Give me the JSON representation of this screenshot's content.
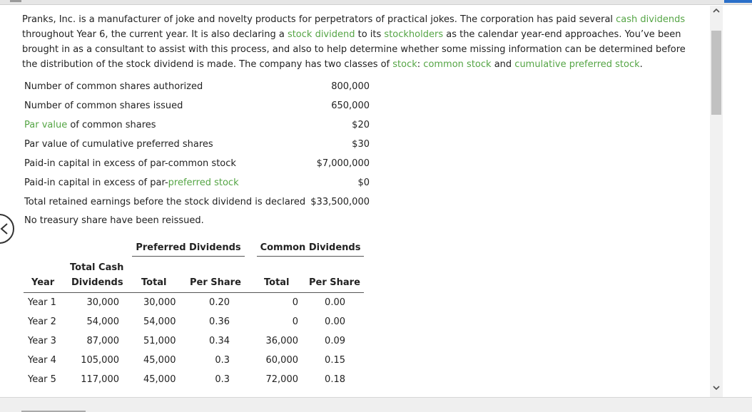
{
  "intro": {
    "t1": "Pranks, Inc. is a manufacturer of joke and novelty products for perpetrators of practical jokes. The corporation has paid several ",
    "l1": "cash dividends",
    "t2": " throughout Year 6, the current year. It is also declaring a ",
    "l2": "stock dividend",
    "t3": " to its ",
    "l3": "stockholders",
    "t4": " as the calendar year-end approaches. You’ve been brought in as a consultant to assist with this process, and also to help determine whether some missing information can be determined before the distribution of the stock dividend is made. The company has two classes of ",
    "l4": "stock",
    "t5": ": ",
    "l5": "common stock",
    "t6": " and ",
    "l6": "cumulative preferred stock",
    "t7": "."
  },
  "facts": [
    {
      "label": "Number of common shares authorized",
      "value": "800,000"
    },
    {
      "label": "Number of common shares issued",
      "value": "650,000"
    },
    {
      "label_link": "Par value",
      "label_rest": " of common shares",
      "value": "$20"
    },
    {
      "label": "Par value of cumulative preferred shares",
      "value": "$30"
    },
    {
      "label": "Paid-in capital in excess of par-common stock",
      "value": "$7,000,000"
    },
    {
      "label_pre": "Paid-in capital in excess of par-",
      "label_link": "preferred stock",
      "value": "$0"
    },
    {
      "label": "Total retained earnings before the stock dividend is declared",
      "value": "$33,500,000"
    }
  ],
  "note": "No treasury share have been reissued.",
  "table": {
    "group_preferred": "Preferred Dividends",
    "group_common": "Common Dividends",
    "headers": {
      "year": "Year",
      "total_cash_1": "Total Cash",
      "total_cash_2": "Dividends",
      "pref_total": "Total",
      "pref_per_share": "Per Share",
      "common_total": "Total",
      "common_per_share": "Per Share"
    },
    "rows": [
      {
        "year": "Year 1",
        "cash": "30,000",
        "pref_total": "30,000",
        "pref_ps": "0.20",
        "com_total": "0",
        "com_ps": "0.00"
      },
      {
        "year": "Year 2",
        "cash": "54,000",
        "pref_total": "54,000",
        "pref_ps": "0.36",
        "com_total": "0",
        "com_ps": "0.00"
      },
      {
        "year": "Year 3",
        "cash": "87,000",
        "pref_total": "51,000",
        "pref_ps": "0.34",
        "com_total": "36,000",
        "com_ps": "0.09"
      },
      {
        "year": "Year 4",
        "cash": "105,000",
        "pref_total": "45,000",
        "pref_ps": "0.3",
        "com_total": "60,000",
        "com_ps": "0.15"
      },
      {
        "year": "Year 5",
        "cash": "117,000",
        "pref_total": "45,000",
        "pref_ps": "0.3",
        "com_total": "72,000",
        "com_ps": "0.18"
      }
    ]
  },
  "colors": {
    "link": "#55a545",
    "text": "#222222",
    "scroll_thumb": "#c1c1c1"
  },
  "icons": {
    "prev": "chevron-left-icon",
    "scroll_up": "chevron-up-icon",
    "scroll_down": "chevron-down-icon"
  }
}
